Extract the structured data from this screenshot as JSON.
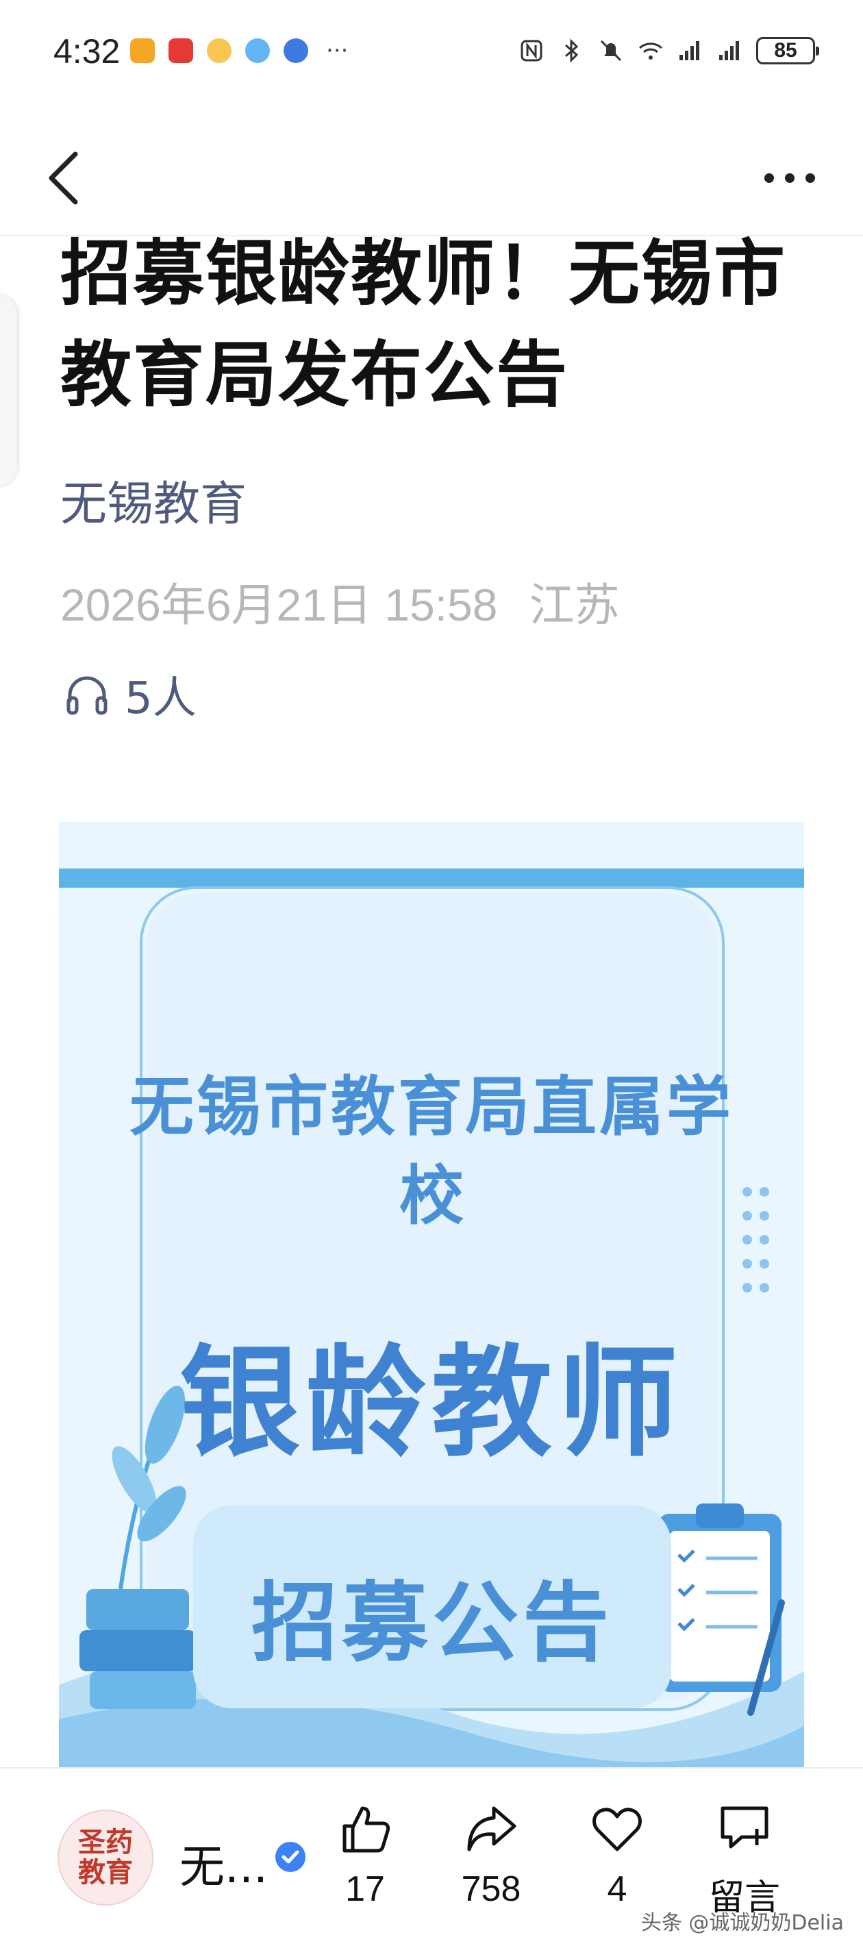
{
  "status_bar": {
    "time": "4:32",
    "more": "···",
    "battery": "85",
    "icons": [
      "nfc-icon",
      "bluetooth-icon",
      "mute-icon",
      "wifi-icon",
      "signal-icon",
      "signal-icon"
    ]
  },
  "article": {
    "title": "招募银龄教师！无锡市教育局发布公告",
    "author": "无锡教育",
    "date": "2026年6月21日 15:58",
    "location": "江苏",
    "listens": "5人"
  },
  "banner": {
    "line1": "无锡市教育局直属学",
    "line2": "校",
    "line3": "银龄教师",
    "line4": "招募公告"
  },
  "bottom_bar": {
    "avatar_text": "圣药\n教育",
    "account_name": "无...",
    "like_count": "17",
    "share_count": "758",
    "favorite_count": "4",
    "comment_label": "留言",
    "watermark": "头条 @诚诚奶奶Delia"
  },
  "colors": {
    "author": "#4e5b7c",
    "meta": "#b7b7b7",
    "banner_text": "#4a90d6",
    "banner_bg": "#eaf6fd",
    "verified": "#3b82f6"
  }
}
